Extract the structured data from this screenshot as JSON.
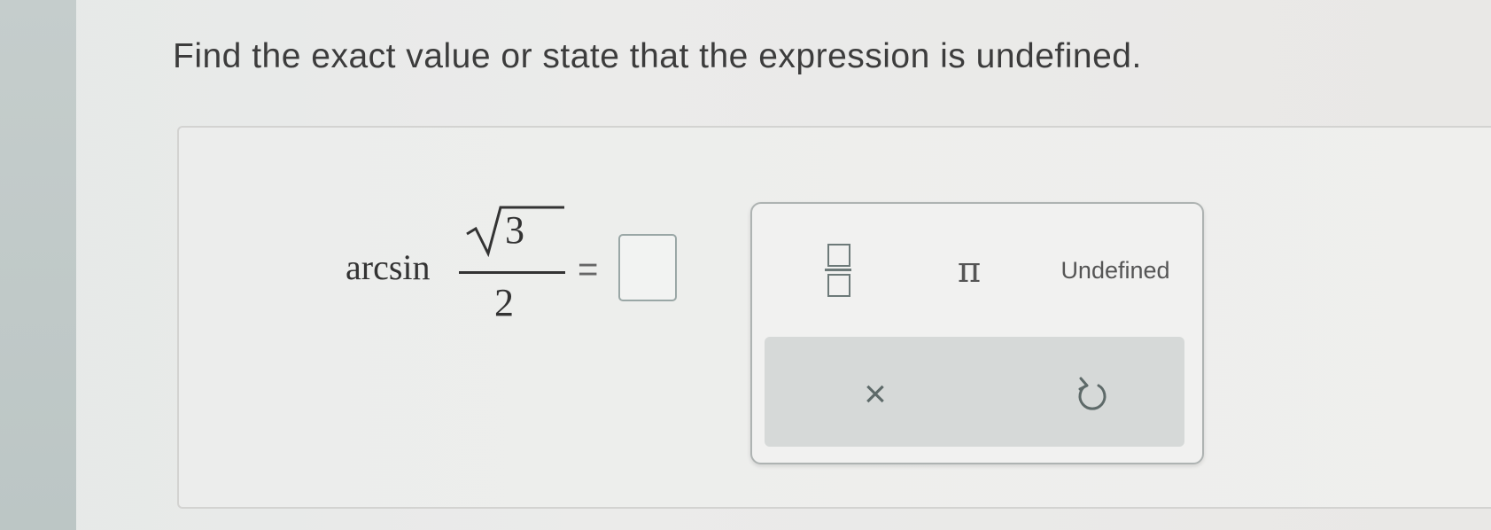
{
  "question": {
    "text": "Find the exact value or state that the expression is undefined."
  },
  "expression": {
    "function": "arcsin",
    "radicand": "3",
    "denominator": "2",
    "equals": "="
  },
  "keypad": {
    "fraction_key": "fraction-icon",
    "pi_label": "π",
    "undefined_label": "Undefined",
    "clear_label": "×",
    "undo_key": "undo-icon"
  },
  "colors": {
    "icon": "#6d7a79",
    "text": "#3c3c3c",
    "footer_bg": "#d6d9d8"
  }
}
